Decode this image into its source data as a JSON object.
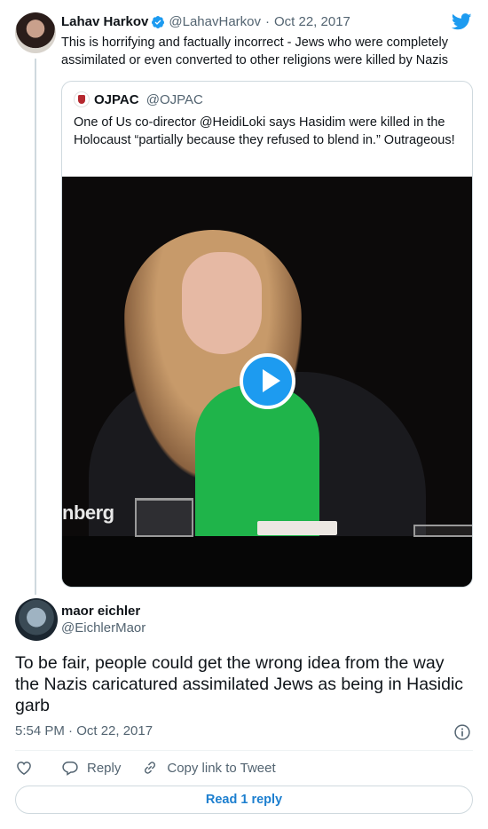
{
  "parent_tweet": {
    "author_name": "Lahav Harkov",
    "handle": "@LahavHarkov",
    "separator": "·",
    "date": "Oct 22, 2017",
    "text": "This is horrifying and factually incorrect - Jews who were completely assimilated or even converted to other religions were killed by Nazis",
    "quoted": {
      "author_name": "OJPAC",
      "handle": "@OJPAC",
      "text": "One of Us co-director @HeidiLoki says Hasidim were killed in the Holocaust “partially because they refused to blend in.” Outrageous!",
      "video_caption": "nberg"
    }
  },
  "reply_tweet": {
    "author_name": "maor eichler",
    "handle": "@EichlerMaor",
    "text": "To be fair, people could get the wrong idea from the way the Nazis caricatured assimilated Jews as being in Hasidic garb",
    "time": "5:54 PM · Oct 22, 2017"
  },
  "actions": {
    "reply_label": "Reply",
    "copy_link_label": "Copy link to Tweet",
    "read_replies_label": "Read 1 reply"
  },
  "icons": {
    "verified": "verified-badge-icon",
    "twitter": "twitter-bird-icon",
    "heart": "heart-icon",
    "reply": "reply-bubble-icon",
    "link": "link-icon",
    "info": "info-icon",
    "play": "play-icon"
  },
  "colors": {
    "accent": "#1d9bf0",
    "text_primary": "#0f1419",
    "text_secondary": "#536471",
    "border": "#cfd9de"
  }
}
